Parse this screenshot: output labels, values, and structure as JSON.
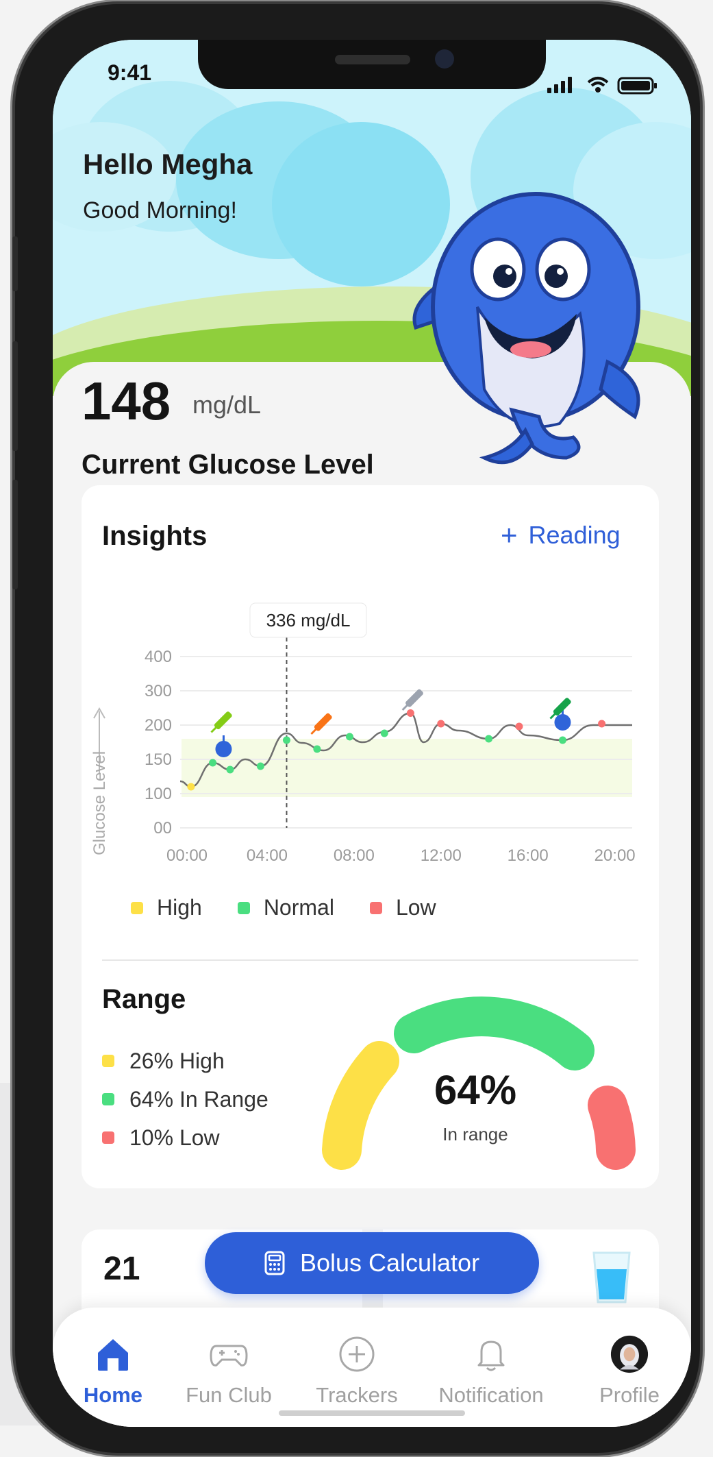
{
  "status_bar": {
    "time": "9:41"
  },
  "greeting": {
    "title": "Hello Megha",
    "subtitle": "Good Morning!"
  },
  "glucose": {
    "value": "148",
    "unit": "mg/dL",
    "label": "Current Glucose Level"
  },
  "insights": {
    "title": "Insights",
    "add_reading_label": "Reading",
    "tooltip": "336 mg/dL",
    "legend": [
      {
        "label": "High",
        "color": "#fde047"
      },
      {
        "label": "Normal",
        "color": "#4ade80"
      },
      {
        "label": "Low",
        "color": "#f87171"
      }
    ]
  },
  "chart_data": {
    "type": "line",
    "ylabel": "Glucose Level",
    "y_ticks": [
      "400",
      "300",
      "200",
      "150",
      "100",
      "00"
    ],
    "x_ticks": [
      "00:00",
      "04:00",
      "08:00",
      "12:00",
      "16:00",
      "20:00"
    ],
    "target_band": [
      90,
      180
    ],
    "series": [
      {
        "values": [
          [
            0.0,
            118
          ],
          [
            0.5,
            110
          ],
          [
            1.5,
            145
          ],
          [
            2.3,
            135
          ],
          [
            3.0,
            150
          ],
          [
            3.7,
            140
          ],
          [
            4.9,
            188
          ],
          [
            5.6,
            174
          ],
          [
            6.6,
            163
          ],
          [
            7.6,
            185
          ],
          [
            8.4,
            175
          ],
          [
            9.4,
            190
          ],
          [
            10.6,
            235
          ],
          [
            11.2,
            175
          ],
          [
            12.0,
            204
          ],
          [
            12.8,
            192
          ],
          [
            14.2,
            180
          ],
          [
            15.2,
            200
          ],
          [
            16.0,
            185
          ],
          [
            17.6,
            178
          ],
          [
            19.0,
            200
          ],
          [
            20.8,
            200
          ]
        ]
      }
    ],
    "points": [
      {
        "x": 0.5,
        "y": 110,
        "status": "high"
      },
      {
        "x": 1.5,
        "y": 145,
        "status": "normal"
      },
      {
        "x": 2.3,
        "y": 135,
        "status": "normal"
      },
      {
        "x": 3.7,
        "y": 140,
        "status": "normal"
      },
      {
        "x": 4.9,
        "y": 178,
        "status": "normal"
      },
      {
        "x": 6.3,
        "y": 165,
        "status": "normal"
      },
      {
        "x": 7.8,
        "y": 183,
        "status": "normal"
      },
      {
        "x": 9.4,
        "y": 188,
        "status": "normal"
      },
      {
        "x": 10.6,
        "y": 235,
        "status": "low"
      },
      {
        "x": 12.0,
        "y": 204,
        "status": "low"
      },
      {
        "x": 14.2,
        "y": 180,
        "status": "normal"
      },
      {
        "x": 15.6,
        "y": 198,
        "status": "low"
      },
      {
        "x": 17.6,
        "y": 178,
        "status": "normal"
      },
      {
        "x": 19.4,
        "y": 204,
        "status": "low"
      }
    ],
    "cursor_x": 4.9,
    "markers": [
      {
        "x": 2.0,
        "y": 165,
        "kind": "apple-icon"
      },
      {
        "x": 2.0,
        "y": 215,
        "kind": "pen-lime-icon"
      },
      {
        "x": 6.6,
        "y": 210,
        "kind": "pen-orange-icon"
      },
      {
        "x": 10.8,
        "y": 280,
        "kind": "pen-gray-icon"
      },
      {
        "x": 17.6,
        "y": 208,
        "kind": "apple-icon"
      },
      {
        "x": 17.6,
        "y": 255,
        "kind": "pen-green-icon"
      }
    ]
  },
  "range": {
    "title": "Range",
    "items": [
      {
        "label": "26% High",
        "color": "#fde047",
        "percent": 26
      },
      {
        "label": "64% In Range",
        "color": "#4ade80",
        "percent": 64
      },
      {
        "label": "10% Low",
        "color": "#f87171",
        "percent": 10
      }
    ],
    "gauge_value": "64%",
    "gauge_label": "In range"
  },
  "lower_card": {
    "number": "21"
  },
  "bolus": {
    "label": "Bolus Calculator"
  },
  "tabs": [
    {
      "label": "Home",
      "icon": "home-icon",
      "active": true
    },
    {
      "label": "Fun Club",
      "icon": "gamepad-icon",
      "active": false
    },
    {
      "label": "Trackers",
      "icon": "plus-circle-icon",
      "active": false
    },
    {
      "label": "Notification",
      "icon": "bell-icon",
      "active": false
    },
    {
      "label": "Profile",
      "icon": "avatar-icon",
      "active": false
    }
  ],
  "colors": {
    "accent": "#2e5fd8",
    "high": "#fde047",
    "normal": "#4ade80",
    "low": "#f87171"
  }
}
